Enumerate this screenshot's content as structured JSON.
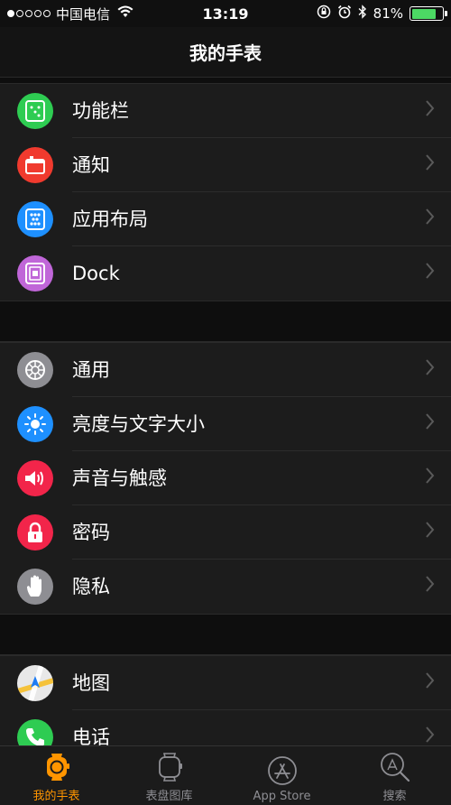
{
  "status_bar": {
    "carrier": "中国电信",
    "time": "13:19",
    "battery_percent": "81%",
    "battery_level": 0.81,
    "signal_bars_filled": 1,
    "signal_bars_total": 5
  },
  "nav": {
    "title": "我的手表"
  },
  "groups": [
    {
      "items": [
        {
          "label": "功能栏",
          "icon": "glances-icon",
          "color": "#2ecc52"
        },
        {
          "label": "通知",
          "icon": "notifications-icon",
          "color": "#f03a2e"
        },
        {
          "label": "应用布局",
          "icon": "app-layout-icon",
          "color": "#1e90ff"
        },
        {
          "label": "Dock",
          "icon": "dock-icon",
          "color": "#c066d8"
        }
      ]
    },
    {
      "items": [
        {
          "label": "通用",
          "icon": "gear-icon",
          "color": "#8e8e93"
        },
        {
          "label": "亮度与文字大小",
          "icon": "brightness-icon",
          "color": "#1e90ff"
        },
        {
          "label": "声音与触感",
          "icon": "sound-icon",
          "color": "#f2254a"
        },
        {
          "label": "密码",
          "icon": "lock-icon",
          "color": "#f2254a"
        },
        {
          "label": "隐私",
          "icon": "hand-icon",
          "color": "#8e8e93"
        }
      ]
    },
    {
      "items": [
        {
          "label": "地图",
          "icon": "maps-icon",
          "color": "#e8e8e8"
        },
        {
          "label": "电话",
          "icon": "phone-icon",
          "color": "#2ecc52"
        }
      ]
    }
  ],
  "tabs": [
    {
      "label": "我的手表",
      "icon": "my-watch-icon",
      "active": true
    },
    {
      "label": "表盘图库",
      "icon": "face-gallery-icon",
      "active": false
    },
    {
      "label": "App Store",
      "icon": "app-store-icon",
      "active": false
    },
    {
      "label": "搜索",
      "icon": "search-icon",
      "active": false
    }
  ],
  "colors": {
    "accent": "#ff9500",
    "background": "#1c1c1c",
    "battery": "#4cd964"
  }
}
